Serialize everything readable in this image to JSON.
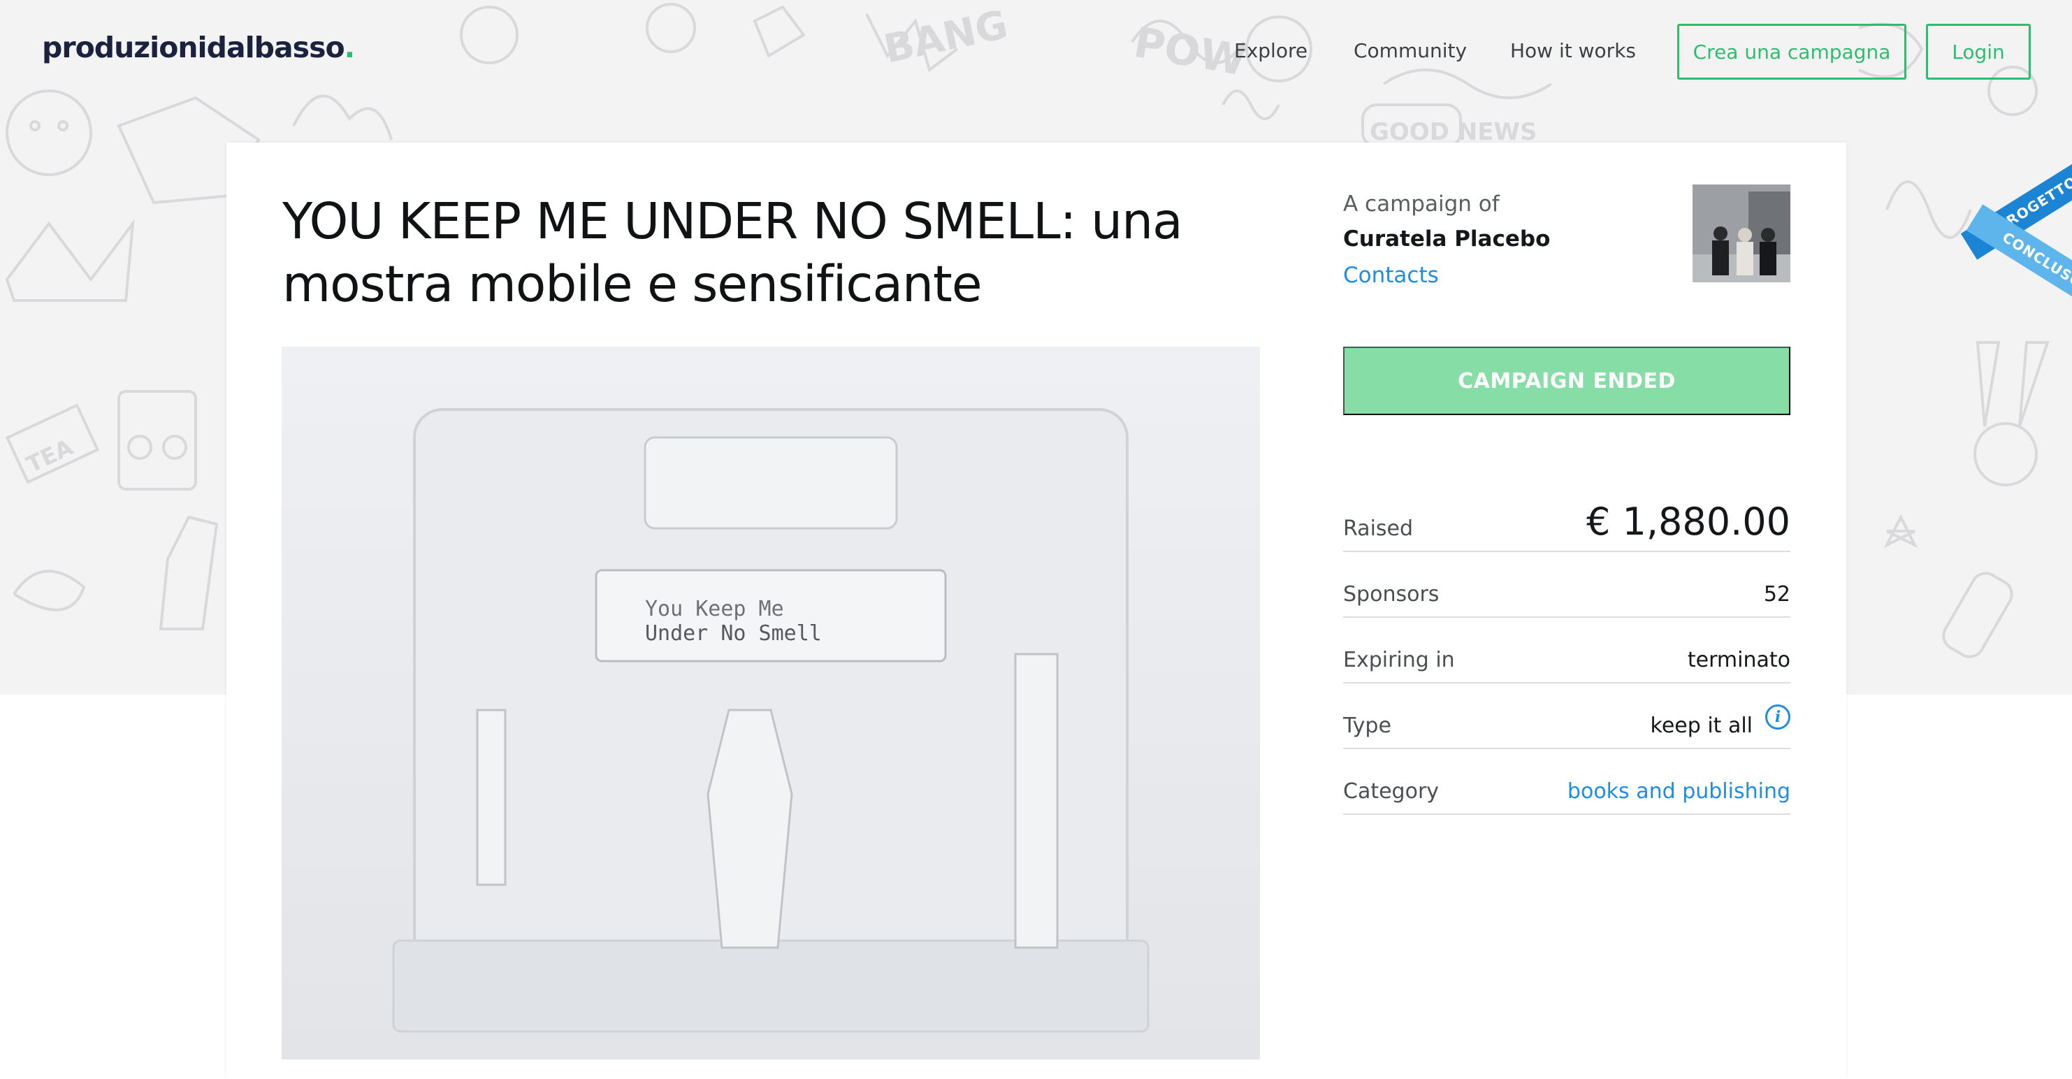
{
  "header": {
    "logo_main": "produzionidalbasso",
    "logo_dot": ".",
    "nav": [
      "Explore",
      "Community",
      "How it works"
    ],
    "create_label": "Crea una campagna",
    "login_label": "Login"
  },
  "campaign": {
    "title": "YOU KEEP ME UNDER NO SMELL: una mostra mobile e sensificante",
    "media_text_line1": "You Keep Me",
    "media_text_line2": "Under No Smell"
  },
  "sidebar": {
    "caption": "A campaign of",
    "author": "Curatela Placebo",
    "contacts_label": "Contacts",
    "status_button": "CAMPAIGN ENDED",
    "stats": [
      {
        "label": "Raised",
        "value": "€ 1,880.00"
      },
      {
        "label": "Sponsors",
        "value": "52"
      },
      {
        "label": "Expiring in",
        "value": "terminato"
      },
      {
        "label": "Type",
        "value": "keep it all",
        "info_icon": "info-icon"
      },
      {
        "label": "Category",
        "value": "books and publishing"
      }
    ]
  },
  "ribbon": {
    "line1": "PROGETTO",
    "line2": "CONCLUSO"
  },
  "colors": {
    "brand_green": "#2dbd6e",
    "ended_button": "#86dea6",
    "link_blue": "#1f8de0",
    "ribbon_dark": "#1c84d4",
    "ribbon_light": "#5eb5ec"
  },
  "doodles": {
    "bang": "BANG",
    "pow": "POW",
    "good_news": "GOOD NEWS",
    "tea": "TEA"
  }
}
